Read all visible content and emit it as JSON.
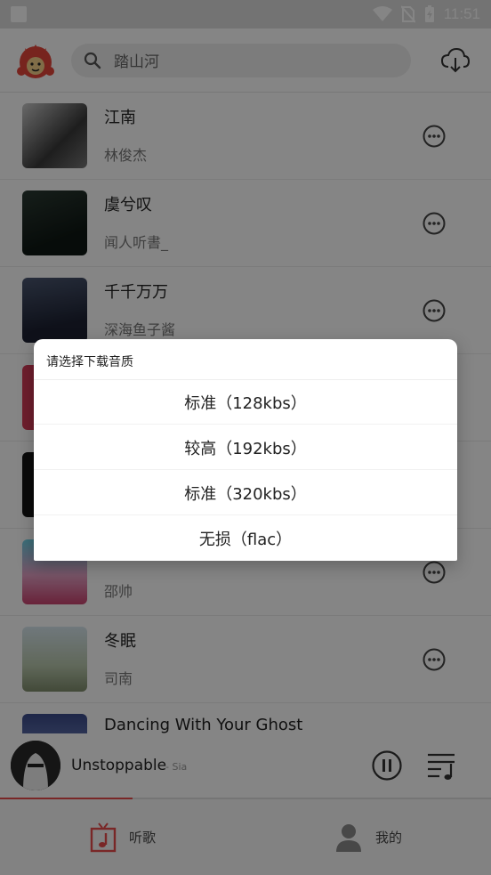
{
  "status_bar": {
    "time": "11:51"
  },
  "search": {
    "text": "踏山河"
  },
  "songs": [
    {
      "title": "江南",
      "artist": "林俊杰"
    },
    {
      "title": "虞兮叹",
      "artist": "闻人听書_"
    },
    {
      "title": "千千万万",
      "artist": "深海鱼子酱"
    },
    {
      "title": "",
      "artist": ""
    },
    {
      "title": "",
      "artist": ""
    },
    {
      "title": "",
      "artist": "邵帅"
    },
    {
      "title": "冬眠",
      "artist": "司南"
    },
    {
      "title": "Dancing With Your Ghost",
      "artist": ""
    }
  ],
  "player": {
    "title": "Unstoppable",
    "artist": "- Sia",
    "progress_fraction": 0.27
  },
  "nav": {
    "listen": "听歌",
    "mine": "我的"
  },
  "dialog": {
    "title": "请选择下载音质",
    "options": [
      "标准（128kbs）",
      "较高（192kbs）",
      "标准（320kbs）",
      "无损（flac）"
    ]
  },
  "colors": {
    "accent": "#e84b4b"
  }
}
